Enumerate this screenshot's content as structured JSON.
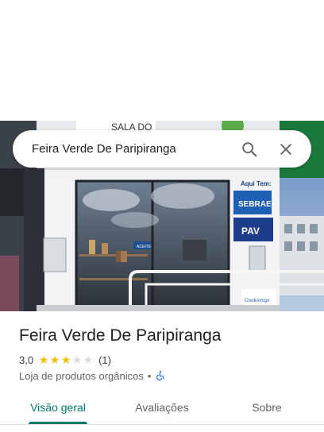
{
  "search": {
    "value": "Feira Verde De Paripiranga",
    "search_icon": "search-icon",
    "close_icon": "close-icon"
  },
  "hero_photo": {
    "facade_sign": "SALA DO",
    "aqui_tem": "Aqui Tem:",
    "sebrae": "SEBRAE",
    "pav": "PAV",
    "aceite": "ACEITE",
    "crediamigo": "CrediAmigo"
  },
  "place": {
    "name": "Feira Verde De Paripiranga",
    "rating": "3,0",
    "stars_filled": 3,
    "stars_total": 5,
    "review_count": "(1)",
    "category": "Loja de produtos orgânicos",
    "separator": "•",
    "accessibility_icon": "wheelchair-icon"
  },
  "tabs": [
    {
      "label": "Visão geral",
      "active": true
    },
    {
      "label": "Avaliações",
      "active": false
    },
    {
      "label": "Sobre",
      "active": false
    }
  ],
  "colors": {
    "accent": "#00796b",
    "star_filled": "#fbbc04",
    "star_empty": "#dadce0",
    "accessibility": "#1a73e8"
  }
}
